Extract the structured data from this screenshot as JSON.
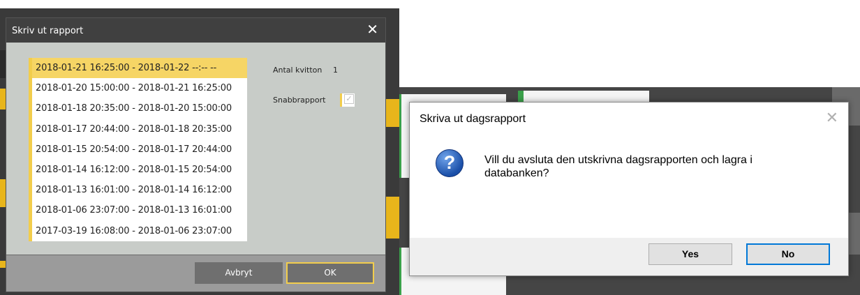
{
  "left_dialog": {
    "title": "Skriv ut rapport",
    "close_glyph": "✕",
    "rows": [
      "2018-01-21 16:25:00  -  2018-01-22 --:-- --",
      "2018-01-20 15:00:00  -  2018-01-21 16:25:00",
      "2018-01-18 20:35:00  -  2018-01-20 15:00:00",
      "2018-01-17 20:44:00  -  2018-01-18 20:35:00",
      "2018-01-15 20:54:00  -  2018-01-17 20:44:00",
      "2018-01-14 16:12:00  -  2018-01-15 20:54:00",
      "2018-01-13 16:01:00  -  2018-01-14 16:12:00",
      "2018-01-06 23:07:00  -  2018-01-13 16:01:00",
      "2017-03-19 16:08:00  -  2018-01-06 23:07:00"
    ],
    "antal_label": "Antal kvitton",
    "antal_value": "1",
    "snabb_label": "Snabbrapport",
    "cancel_label": "Avbryt",
    "ok_label": "OK"
  },
  "right_dialog": {
    "title": "Skriva ut dagsrapport",
    "close_glyph": "✕",
    "message_line1": "Vill du avsluta den utskrivna dagsrapporten och lagra i",
    "message_line2": "databanken?",
    "icon": "question-icon",
    "yes_label": "Yes",
    "no_label": "No"
  },
  "colors": {
    "accent_yellow": "#f2cd4c",
    "selected_row": "#f6d565",
    "dialog_gray": "#c8ccc8",
    "title_dark": "#404040",
    "focus_blue": "#0078d7"
  }
}
